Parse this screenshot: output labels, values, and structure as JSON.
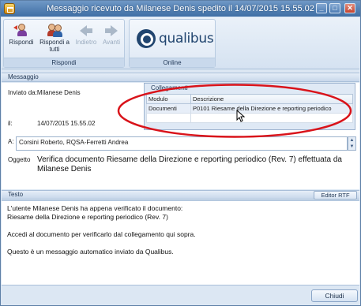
{
  "window": {
    "title": "Messaggio ricevuto da Milanese Denis spedito il 14/07/2015 15.55.02",
    "controls": {
      "minimize": "_",
      "maximize": "□",
      "close": "✕"
    }
  },
  "ribbon": {
    "groups": [
      {
        "label": "Rispondi",
        "buttons": [
          {
            "label": "Rispondi",
            "icon": "reply-person-icon",
            "enabled": true
          },
          {
            "label": "Rispondi a tutti",
            "icon": "reply-all-people-icon",
            "enabled": true
          },
          {
            "label": "Indietro",
            "icon": "arrow-left-icon",
            "enabled": false
          },
          {
            "label": "Avanti",
            "icon": "arrow-right-icon",
            "enabled": false
          }
        ]
      },
      {
        "label": "Online",
        "logo_text": "qualibus"
      }
    ]
  },
  "messaggio": {
    "section_label": "Messaggio",
    "inviato_da": "Inviato da:Milanese Denis",
    "il_label": "il:",
    "date": "14/07/2015 15.55.02",
    "a_label": "A:",
    "recipients": "Corsini Roberto, RQSA-Ferretti Andrea",
    "oggetto_label": "Oggetto",
    "oggetto_line1": "Verifica documento Riesame della Direzione e reporting periodico (Rev. 7) effettuata da",
    "oggetto_line2": "Milanese Denis"
  },
  "collegamenti": {
    "title": "Collegamenti",
    "columns": [
      "Modulo",
      "Descrizione"
    ],
    "rows": [
      {
        "modulo": "Documenti",
        "descrizione": "P0101 Riesame della Direzione e reporting periodico"
      }
    ],
    "highlight_color": "#d9131a"
  },
  "testo": {
    "section_label": "Testo",
    "editor_button": "Editor RTF",
    "lines": [
      "L'utente Milanese Denis ha appena verificato il documento:",
      "Riesame della Direzione e reporting periodico (Rev. 7)",
      "",
      "Accedi al documento per verificarlo dal collegamento qui sopra.",
      "",
      "Questo è un messaggio automatico inviato da Qualibus."
    ]
  },
  "footer": {
    "close_button": "Chiudi"
  }
}
